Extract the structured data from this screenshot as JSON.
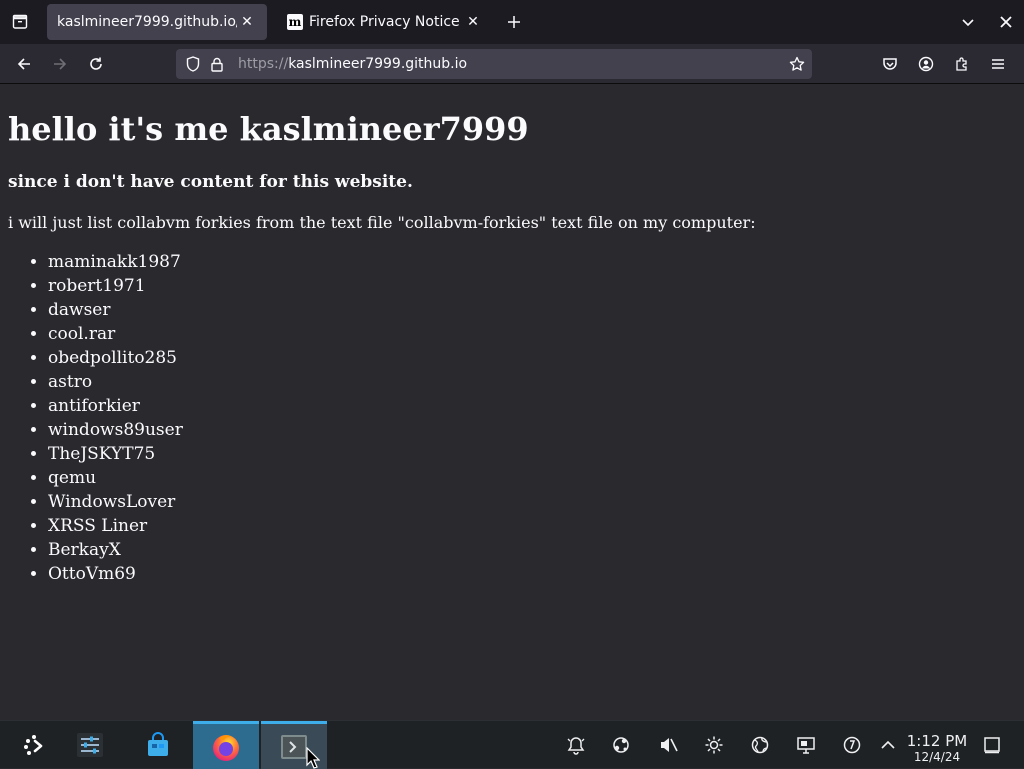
{
  "browser": {
    "tabs": [
      {
        "title": "kaslmineer7999.github.io/",
        "active": true
      },
      {
        "title": "Firefox Privacy Notice —",
        "favicon_letter": "m",
        "active": false
      }
    ],
    "url": {
      "scheme": "https://",
      "host": "kaslmineer7999.github.io"
    }
  },
  "page": {
    "heading": "hello it's me kaslmineer7999",
    "subheading": "since i don't have content for this website.",
    "intro": "i will just list collabvm forkies from the text file \"collabvm-forkies\" text file on my computer:",
    "forkies": [
      "maminakk1987",
      "robert1971",
      "dawser",
      "cool.rar",
      "obedpollito285",
      "astro",
      "antiforkier",
      "windows89user",
      "TheJSKYT75",
      "qemu",
      "WindowsLover",
      "XRSS Liner",
      "BerkayX",
      "OttoVm69"
    ]
  },
  "taskbar": {
    "time": "1:12 PM",
    "date": "12/4/24"
  },
  "colors": {
    "accent": "#3daee9",
    "tab_active": "#42414d",
    "page_bg": "#2a2a2e"
  }
}
